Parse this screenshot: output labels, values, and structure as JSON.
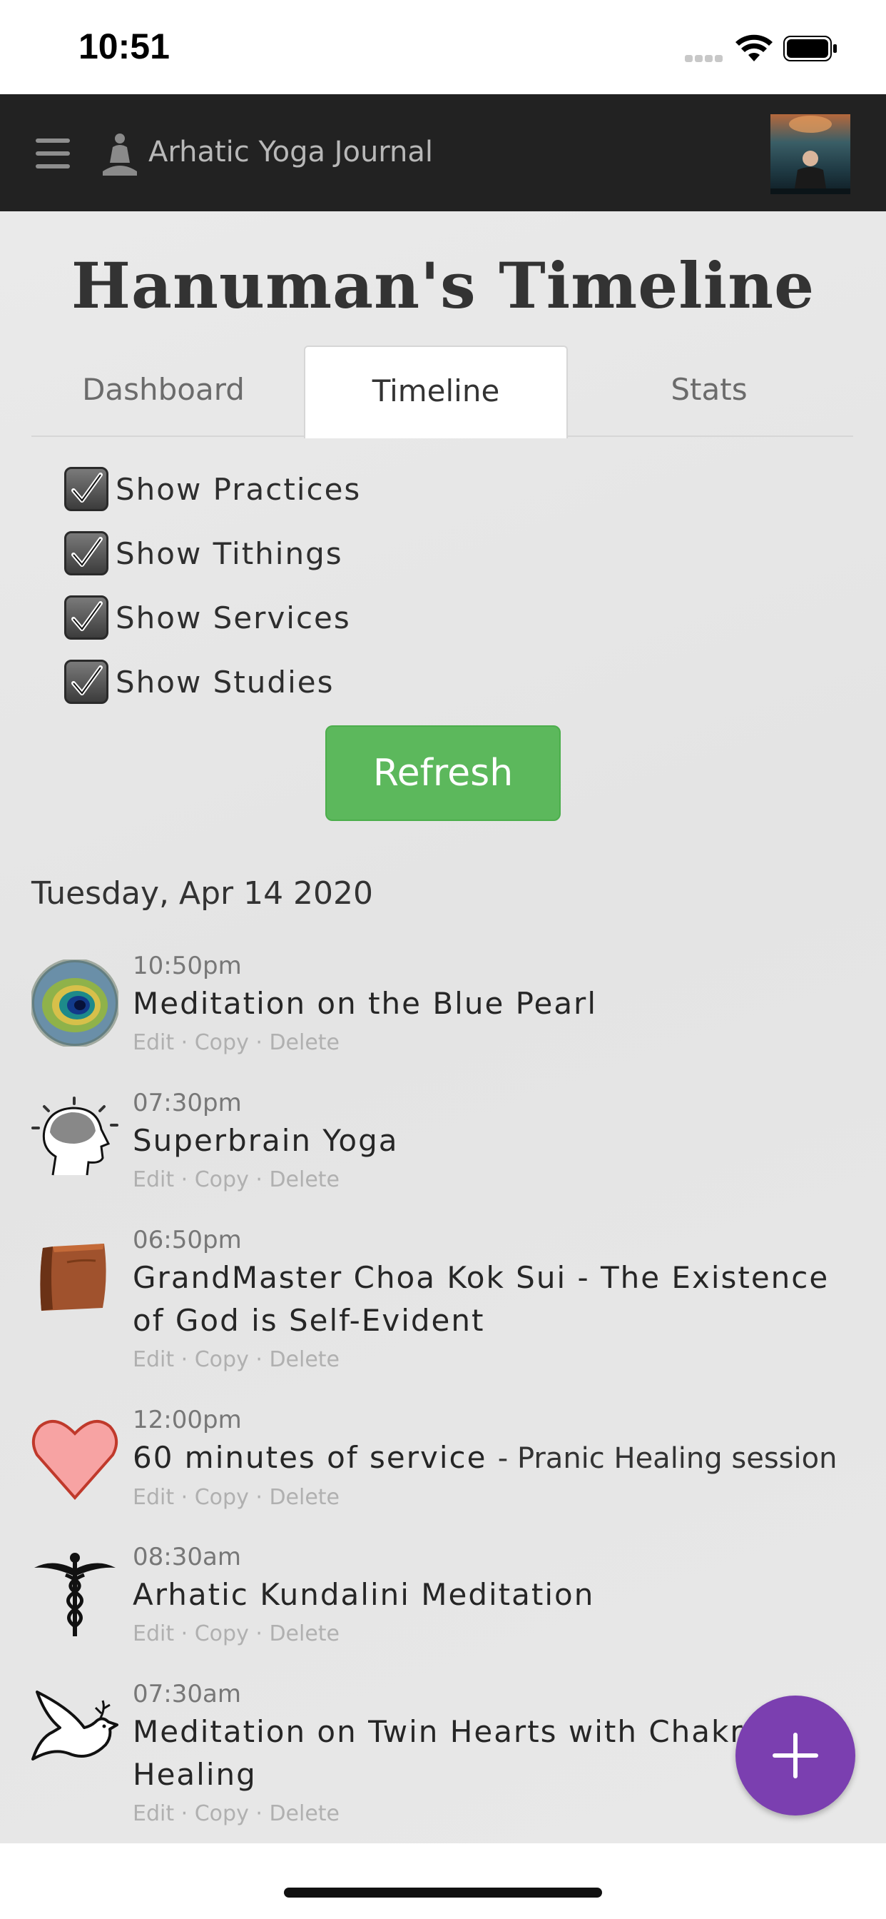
{
  "status_bar": {
    "time": "10:51"
  },
  "app_bar": {
    "title": "Arhatic Yoga Journal"
  },
  "page": {
    "title": "Hanuman's Timeline"
  },
  "tabs": [
    {
      "label": "Dashboard",
      "active": false
    },
    {
      "label": "Timeline",
      "active": true
    },
    {
      "label": "Stats",
      "active": false
    }
  ],
  "filters": [
    {
      "label": "Show Practices",
      "checked": true
    },
    {
      "label": "Show Tithings",
      "checked": true
    },
    {
      "label": "Show Services",
      "checked": true
    },
    {
      "label": "Show Studies",
      "checked": true
    }
  ],
  "refresh_label": "Refresh",
  "timeline": {
    "date": "Tuesday, Apr 14 2020",
    "actions": {
      "edit": "Edit",
      "copy": "Copy",
      "delete": "Delete",
      "separator": " · "
    },
    "entries": [
      {
        "time": "10:50pm",
        "title": "Meditation on the Blue Pearl",
        "subtitle": "",
        "icon": "peacock-feather-icon"
      },
      {
        "time": "07:30pm",
        "title": "Superbrain Yoga",
        "subtitle": "",
        "icon": "brain-head-icon"
      },
      {
        "time": "06:50pm",
        "title": "GrandMaster Choa Kok Sui - The Existence of God is Self-Evident",
        "subtitle": "",
        "icon": "book-icon"
      },
      {
        "time": "12:00pm",
        "title": "60 minutes of service",
        "subtitle": "- Pranic Healing session",
        "icon": "heart-icon"
      },
      {
        "time": "08:30am",
        "title": "Arhatic Kundalini Meditation",
        "subtitle": "",
        "icon": "caduceus-icon"
      },
      {
        "time": "07:30am",
        "title": "Meditation on Twin Hearts with Chakral Healing",
        "subtitle": "",
        "icon": "dove-icon"
      }
    ]
  },
  "colors": {
    "app_bar": "#222222",
    "refresh": "#5cb85c",
    "fab": "#7b3fb0",
    "heart": "#f7a3a3"
  }
}
